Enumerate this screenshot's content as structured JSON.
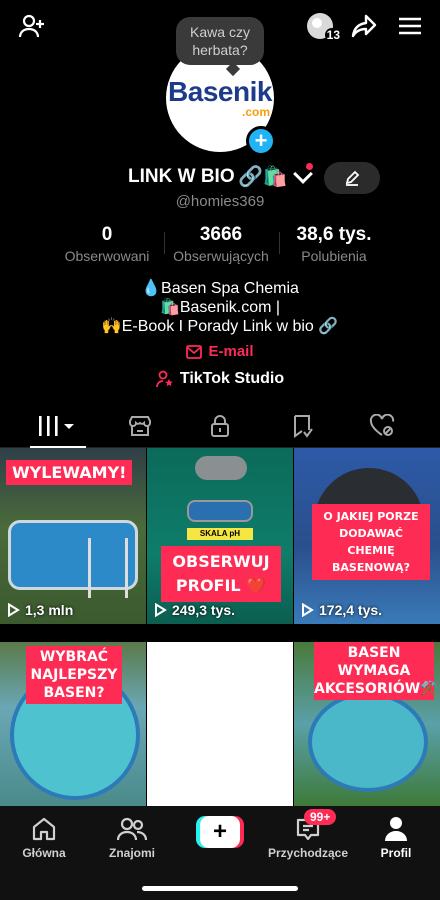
{
  "header": {
    "icons": [
      "add-user-icon",
      "notification-avatar-icon",
      "share-icon",
      "menu-icon"
    ],
    "notification_count": "13"
  },
  "tooltip": {
    "line1": "Kawa czy",
    "line2": "herbata?"
  },
  "profile": {
    "avatar_logo_main": "Basenik",
    "avatar_logo_suffix": ".com",
    "name": "LINK W BIO",
    "name_emojis": "🔗🛍️",
    "username": "@homies369"
  },
  "stats": [
    {
      "value": "0",
      "label": "Obserwowani"
    },
    {
      "value": "3666",
      "label": "Obserwujących"
    },
    {
      "value": "38,6 tys.",
      "label": "Polubienia"
    }
  ],
  "bio": {
    "line1": "💧Basen Spa Chemia",
    "line2": "🛍️Basenik.com |",
    "line3": "🙌E-Book I Porady Link w bio 🔗"
  },
  "email_label": "E-mail",
  "studio_label": "TikTok Studio",
  "tabs": [
    "videos-tab",
    "shop-tab",
    "private-tab",
    "reposts-tab",
    "liked-tab"
  ],
  "videos": [
    {
      "label": "WYLEWAMY!",
      "views": "1,3 mln"
    },
    {
      "label": "OBSERWUJ PROFIL ❤️",
      "sublabel": "SKALA pH",
      "views": "249,3 tys."
    },
    {
      "label": "O JAKIEJ PORZE DODAWAĆ CHEMIĘ BASENOWĄ?",
      "views": "172,4 tys."
    },
    {
      "label": "WYBRAĆ NAJLEPSZY BASEN?"
    },
    {
      "label": ""
    },
    {
      "label": "BASEN WYMAGA AKCESORIÓW⚒️"
    }
  ],
  "nav": {
    "home": "Główna",
    "friends": "Znajomi",
    "create": "+",
    "inbox": "Przychodzące",
    "inbox_badge": "99+",
    "profile": "Profil"
  },
  "colors": {
    "accent": "#fe2c55",
    "cyan": "#25f4ee",
    "avatar_plus": "#20b4f5"
  }
}
